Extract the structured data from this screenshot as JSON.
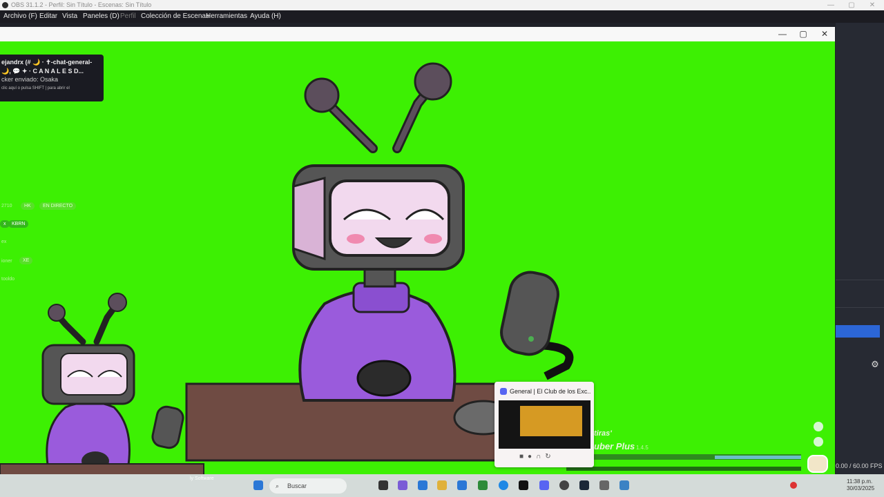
{
  "window_title": "OBS 31.1.2 - Perfil: Sin Título - Escenas: Sin Título",
  "menu": [
    {
      "label": "Archivo (F)",
      "dim": false
    },
    {
      "label": "Editar",
      "dim": false
    },
    {
      "label": "Vista",
      "dim": false
    },
    {
      "label": "Paneles (D)",
      "dim": false
    },
    {
      "label": "Perfil",
      "dim": true
    },
    {
      "label": "Colección de Escenas",
      "dim": false
    },
    {
      "label": "Herramientas",
      "dim": false
    },
    {
      "label": "Ayuda (H)",
      "dim": false
    }
  ],
  "notification": {
    "line1": "ejandrx (# 🌙 · ✝-chat-general-",
    "line2": "🌙, 💬 ✦ · C A N A L E S  D...",
    "line3": "cker enviado: Osaka",
    "line4": "clic aquí o pulsa  SHIFT  |  para abrir el"
  },
  "ghost_chat": {
    "number": "2710",
    "hk": "HK",
    "live": "EN DIRECTO",
    "user": "x",
    "badge": "KBRN",
    "line_a": "ex",
    "line_b": "ioner",
    "line_c": "XE",
    "line_d": "tooldo"
  },
  "overlay": {
    "brand_line1": "tiras'",
    "brand_line2": "uber Plus",
    "version": "1.4.5"
  },
  "discord_popup": {
    "title": "General | El Club de los Exc..."
  },
  "status": {
    "fps": "0.00 / 60.00 FPS"
  },
  "taskbar": {
    "search_label": "Buscar",
    "credit": "ly Software",
    "time": "11:38 p.m.",
    "date": "30/03/2025"
  },
  "colors": {
    "chroma_green": "#3df003",
    "purple": "#9a5bdc",
    "accent_blue": "#2c66d6"
  }
}
